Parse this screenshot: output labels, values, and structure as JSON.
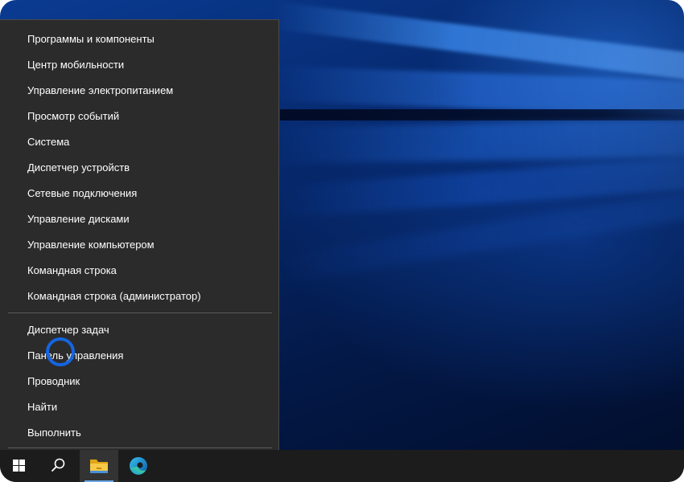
{
  "start_menu_context": {
    "group1": [
      {
        "label": "Программы и компоненты"
      },
      {
        "label": "Центр мобильности"
      },
      {
        "label": "Управление электропитанием"
      },
      {
        "label": "Просмотр событий"
      },
      {
        "label": "Система"
      },
      {
        "label": "Диспетчер устройств"
      },
      {
        "label": "Сетевые подключения"
      },
      {
        "label": "Управление дисками"
      },
      {
        "label": "Управление компьютером"
      },
      {
        "label": "Командная строка"
      },
      {
        "label": "Командная строка (администратор)"
      }
    ],
    "group2": [
      {
        "label": "Диспетчер задач"
      },
      {
        "label": "Панель управления"
      },
      {
        "label": "Проводник"
      },
      {
        "label": "Найти"
      },
      {
        "label": "Выполнить"
      }
    ]
  },
  "taskbar": {
    "icons": [
      "windows-start-icon",
      "search-icon",
      "file-explorer-icon",
      "edge-icon"
    ]
  },
  "colors": {
    "menu_background": "#2b2b2b",
    "taskbar_background": "#1c1c1c",
    "highlight_ring": "#1565e0",
    "wallpaper_primary": "#06296e"
  }
}
